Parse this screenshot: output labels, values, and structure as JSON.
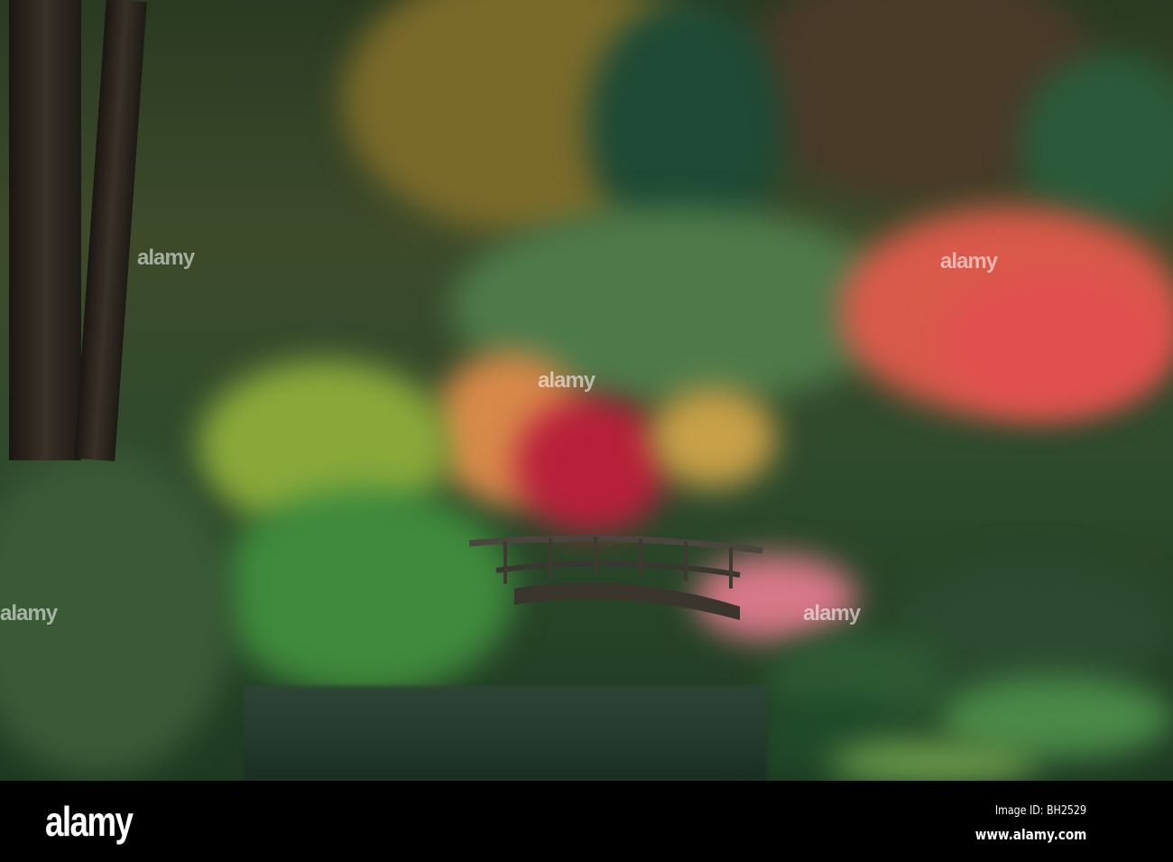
{
  "watermark": "alamy",
  "footer": {
    "logo": "alamy",
    "image_id": "Image ID: BH2529",
    "site": "www.alamy.com"
  },
  "colors": {
    "bar": "#000000",
    "foliage_dark": "#1e3a22",
    "maple_red": "#c8283c",
    "maple_orange": "#e0704a"
  }
}
